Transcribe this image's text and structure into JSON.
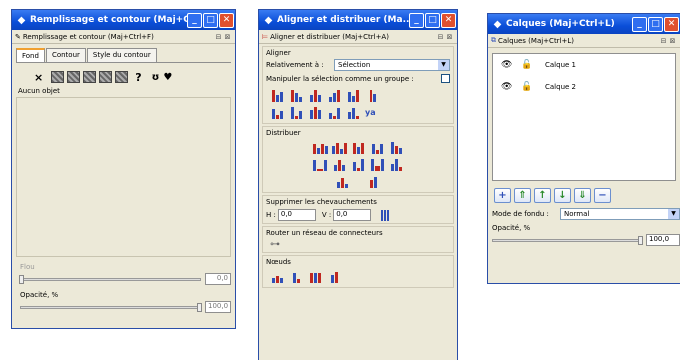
{
  "fill_stroke": {
    "title": "Remplissage et contour (Maj+C...",
    "subtitle": "Remplissage et contour (Maj+Ctrl+F)",
    "tabs": [
      "Fond",
      "Contour",
      "Style du contour"
    ],
    "paint_symbols": {
      "none": "×",
      "unknown": "?",
      "unset": "ʊ",
      "heart": "♥"
    },
    "no_object": "Aucun objet",
    "flou_label": "Flou",
    "flou_value": "0,0",
    "opacity_label": "Opacité, %",
    "opacity_value": "100,0"
  },
  "align": {
    "title": "Aligner et distribuer (Ma...",
    "subtitle": "Aligner et distribuer (Maj+Ctrl+A)",
    "section_align": "Aligner",
    "relative_label": "Relativement à :",
    "relative_value": "Sélection",
    "group_label": "Manipuler la sélection comme un groupe :",
    "section_distribute": "Distribuer",
    "section_overlap": "Supprimer les chevauchements",
    "h_label": "H :",
    "h_value": "0,0",
    "v_label": "V :",
    "v_value": "0,0",
    "section_connectors": "Router un réseau de connecteurs",
    "section_nodes": "Nœuds"
  },
  "layers": {
    "title": "Calques (Maj+Ctrl+L)",
    "subtitle": "Calques (Maj+Ctrl+L)",
    "items": [
      {
        "name": "Calque 1"
      },
      {
        "name": "Calque 2"
      }
    ],
    "blend_label": "Mode de fondu :",
    "blend_value": "Normal",
    "opacity_label": "Opacité, %",
    "opacity_value": "100,0"
  },
  "colors": {
    "titlebar": "#0a4ed8",
    "window_bg": "#ece9d8",
    "close": "#e0502e"
  }
}
